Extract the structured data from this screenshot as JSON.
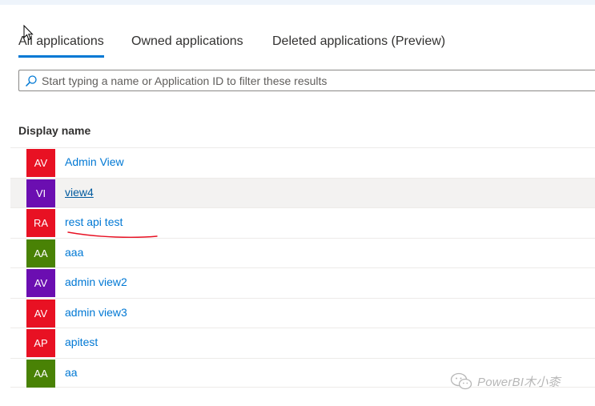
{
  "tabs": [
    {
      "label": "All applications",
      "active": true
    },
    {
      "label": "Owned applications",
      "active": false
    },
    {
      "label": "Deleted applications (Preview)",
      "active": false
    }
  ],
  "search": {
    "placeholder": "Start typing a name or Application ID to filter these results",
    "value": ""
  },
  "table": {
    "column_header": "Display name",
    "rows": [
      {
        "initials": "AV",
        "name": "Admin View",
        "color": "#e81123"
      },
      {
        "initials": "VI",
        "name": "view4",
        "color": "#6b0eb1"
      },
      {
        "initials": "RA",
        "name": "rest api test",
        "color": "#e81123"
      },
      {
        "initials": "AA",
        "name": "aaa",
        "color": "#498205"
      },
      {
        "initials": "AV",
        "name": "admin view2",
        "color": "#6b0eb1"
      },
      {
        "initials": "AV",
        "name": "admin view3",
        "color": "#e81123"
      },
      {
        "initials": "AP",
        "name": "apitest",
        "color": "#e81123"
      },
      {
        "initials": "AA",
        "name": "aa",
        "color": "#498205"
      }
    ]
  },
  "watermark": {
    "text": "PowerBI木小桼",
    "icon": "wechat-icon"
  },
  "colors": {
    "accent": "#0078d4",
    "link": "#0078d4",
    "annotation": "#e81123"
  }
}
